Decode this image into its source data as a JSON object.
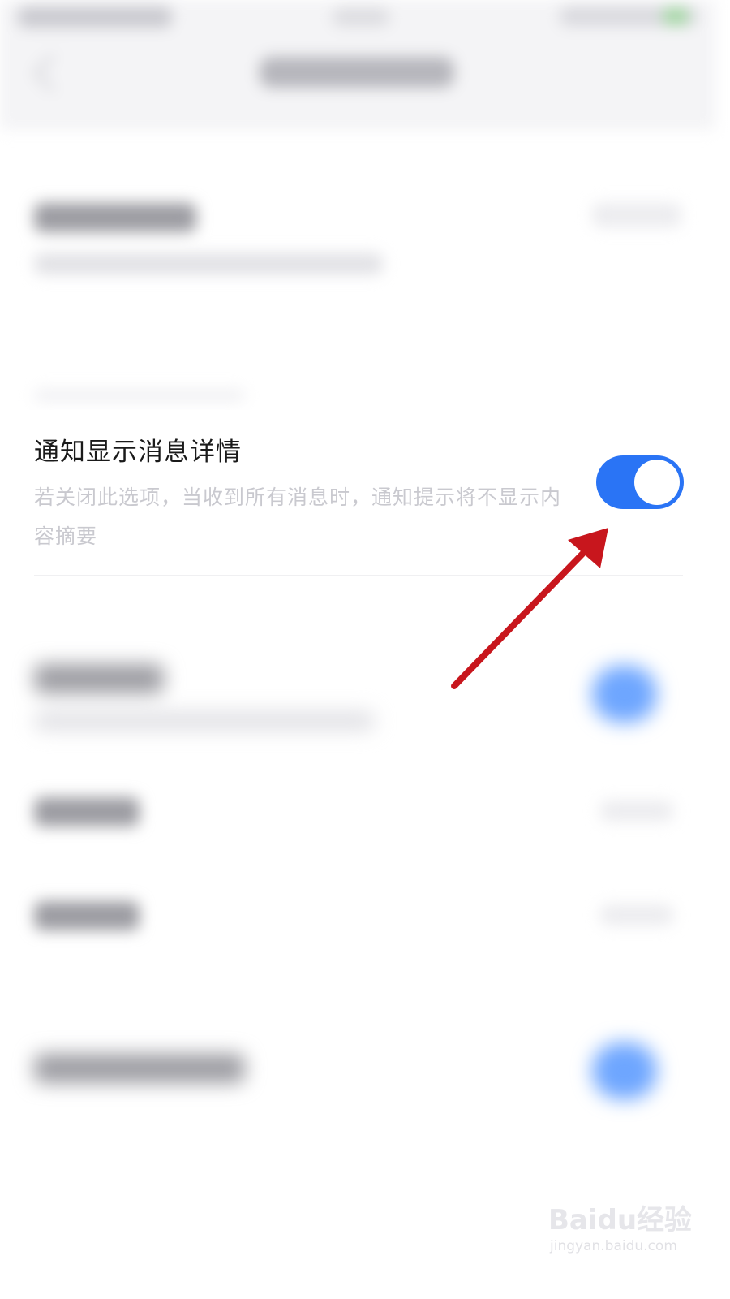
{
  "setting": {
    "title": "通知显示消息详情",
    "description": "若关闭此选项，当收到所有消息时，通知提示将不显示内容摘要",
    "enabled": true
  },
  "colors": {
    "toggle_on": "#2a74f5",
    "arrow": "#c8161d",
    "title_text": "#1a1a1a",
    "description_text": "#c9c9cf"
  },
  "icons": {
    "back": "chevron-left-icon"
  },
  "watermark": {
    "logo": "Baidu经验",
    "url": "jingyan.baidu.com"
  }
}
